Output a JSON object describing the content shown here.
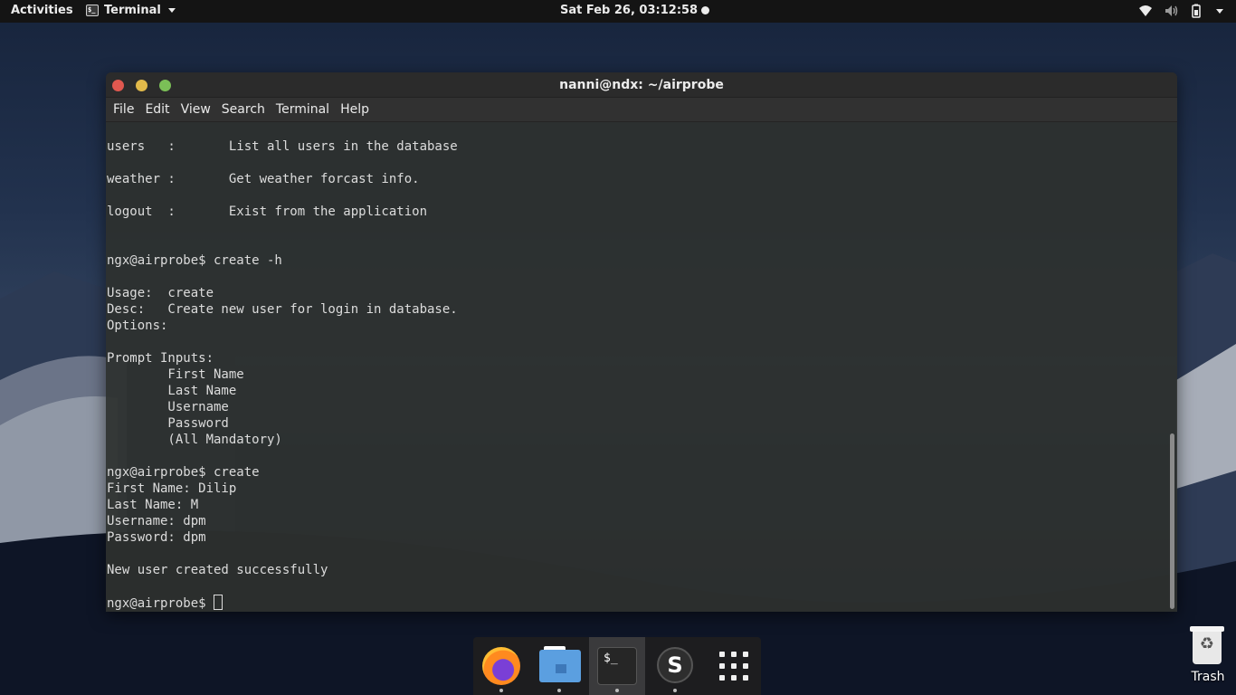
{
  "topbar": {
    "activities": "Activities",
    "app_name": "Terminal",
    "clock": "Sat Feb 26, 03:12:58"
  },
  "window": {
    "title": "nanni@ndx: ~/airprobe",
    "menu": [
      "File",
      "Edit",
      "View",
      "Search",
      "Terminal",
      "Help"
    ]
  },
  "terminal": {
    "lines": [
      "users   :       List all users in the database",
      "",
      "weather :       Get weather forcast info.",
      "",
      "logout  :       Exist from the application",
      "",
      "",
      "ngx@airprobe$ create -h",
      "",
      "Usage:  create",
      "Desc:   Create new user for login in database.",
      "Options:",
      "",
      "Prompt Inputs:",
      "        First Name",
      "        Last Name",
      "        Username",
      "        Password",
      "        (All Mandatory)",
      "",
      "ngx@airprobe$ create",
      "First Name: Dilip",
      "Last Name: M",
      "Username: dpm",
      "Password: dpm",
      "",
      "New user created successfully",
      ""
    ],
    "prompt": "ngx@airprobe$ "
  },
  "dock": {
    "items": [
      "firefox-icon",
      "files-icon",
      "terminal-icon",
      "s-app-icon",
      "app-grid-icon"
    ],
    "terminal_glyph": "$_",
    "s_glyph": "S"
  },
  "desktop": {
    "trash_label": "Trash"
  }
}
